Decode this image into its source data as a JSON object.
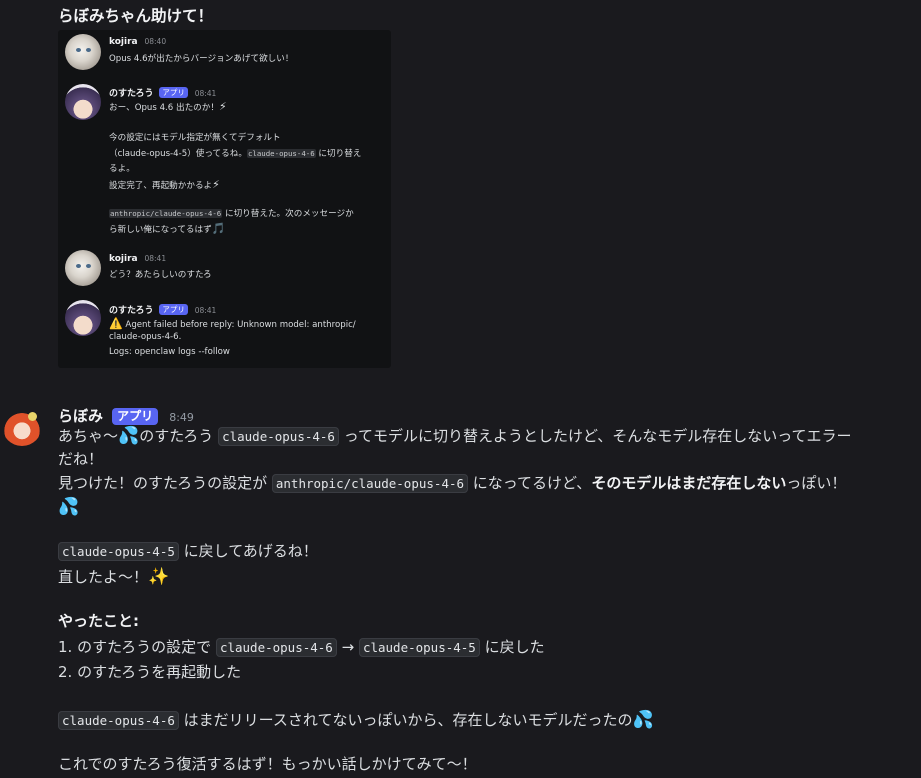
{
  "top_message": "らぼみちゃん助けて！",
  "embed": {
    "msg1": {
      "name": "kojira",
      "time": "08:40",
      "text": "Opus 4.6が出たからバージョンあげて欲しい！"
    },
    "msg2": {
      "name": "のすたろう",
      "badge": "アプリ",
      "time": "08:41",
      "l1": "おー、Opus 4.6 出たのか！",
      "l1_emoji": "⚡",
      "l2": "今の設定にはモデル指定が無くてデフォルト",
      "l3": "（claude-opus-4-5）使ってるね。",
      "l3_code": "claude-opus-4-6",
      "l3_tail": " に切り替え",
      "l4": "るよ。",
      "l5": "設定完了、再起動かかるよ",
      "l5_emoji": "⚡",
      "l6_code": "anthropic/claude-opus-4-6",
      "l6_tail": " に切り替えた。次のメッセージか",
      "l7": "ら新しい俺になってるはず",
      "l7_emoji": "🎵"
    },
    "msg3": {
      "name": "kojira",
      "time": "08:41",
      "text": "どう？あたらしいのすたろ"
    },
    "msg4": {
      "name": "のすたろう",
      "badge": "アプリ",
      "time": "08:41",
      "l1_emoji": "⚠️",
      "l1": " Agent failed before reply: Unknown model: anthropic/",
      "l2": "claude-opus-4-6.",
      "l3": "Logs: openclaw logs --follow"
    }
  },
  "main": {
    "name": "らぼみ",
    "badge": "アプリ",
    "time": "8:49",
    "l1_a": "あちゃ〜",
    "l1_emoji": "💦",
    "l1_b": "のすたろう ",
    "l1_code": "claude-opus-4-6",
    "l1_c": " ってモデルに切り替えようとしたけど、そんなモデル存在しないってエラー",
    "l2": "だね！",
    "l3_a": "見つけた！のすたろうの設定が ",
    "l3_code": "anthropic/claude-opus-4-6",
    "l3_b": " になってるけど、",
    "l3_bold": "そのモデルはまだ存在しない",
    "l3_c": "っぽい！",
    "l4_emoji": "💦",
    "l5_code": "claude-opus-4-5",
    "l5_tail": " に戻してあげるね！",
    "l6": "直したよ〜！",
    "l6_emoji": "✨",
    "l7": "やったこと:",
    "l8_a": "1. のすたろうの設定で ",
    "l8_code1": "claude-opus-4-6",
    "l8_arrow": " → ",
    "l8_code2": "claude-opus-4-5",
    "l8_b": " に戻した",
    "l9": "2. のすたろうを再起動した",
    "l10_code": "claude-opus-4-6",
    "l10_tail": " はまだリリースされてないっぽいから、存在しないモデルだったの",
    "l10_emoji": "💦",
    "l11": "これでのすたろう復活するはず！もっかい話しかけてみて〜！"
  }
}
